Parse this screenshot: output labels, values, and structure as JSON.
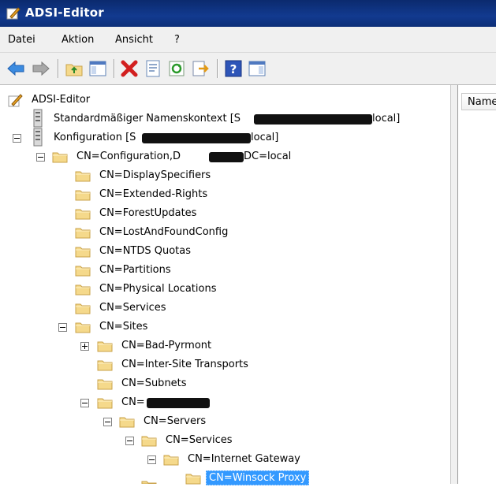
{
  "window": {
    "title": "ADSI-Editor"
  },
  "menu": {
    "items": [
      "Datei",
      "Aktion",
      "Ansicht",
      "?"
    ]
  },
  "list": {
    "column_header": "Name"
  },
  "tree": {
    "root": "ADSI-Editor",
    "default_context": "Standardmäßiger Namenskontext [S",
    "default_context_suffix": "local]",
    "config": "Konfiguration [S",
    "config_suffix": "local]",
    "config_container": "CN=Configuration,D",
    "config_container_suffix": "DC=local",
    "children": [
      "CN=DisplaySpecifiers",
      "CN=Extended-Rights",
      "CN=ForestUpdates",
      "CN=LostAndFoundConfig",
      "CN=NTDS Quotas",
      "CN=Partitions",
      "CN=Physical Locations",
      "CN=Services",
      "CN=Sites"
    ],
    "sites": [
      "CN=Bad-Pyrmont",
      "CN=Inter-Site Transports",
      "CN=Subnets",
      "CN="
    ],
    "servers": "CN=Servers",
    "services": "CN=Services",
    "gateway": "CN=Internet Gateway",
    "selected": "CN=Winsock Proxy"
  },
  "colors": {
    "title_bar": "#123a8f",
    "selection": "#3399ff",
    "folder": "#f5d98b"
  },
  "icons": [
    "back-arrow-icon",
    "forward-arrow-icon",
    "up-folder-icon",
    "show-hide-tree-icon",
    "delete-icon",
    "properties-icon",
    "refresh-icon",
    "export-list-icon",
    "help-icon",
    "console-tree-icon",
    "folder-icon",
    "server-icon",
    "editor-icon"
  ]
}
